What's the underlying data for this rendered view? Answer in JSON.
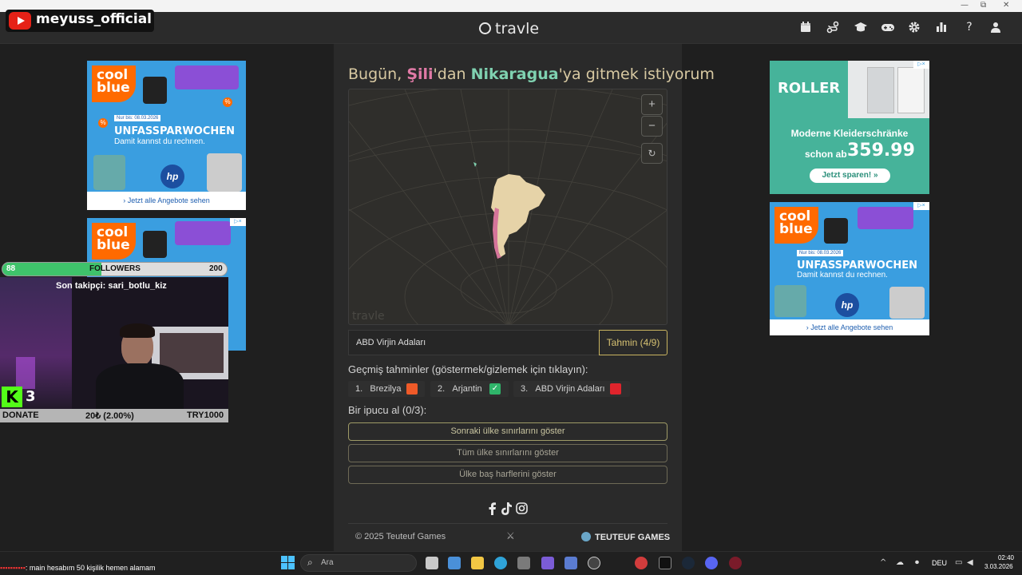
{
  "window": {
    "minimize": "—",
    "maximize": "⧉",
    "close": "✕"
  },
  "header": {
    "brand": "travle",
    "icons": [
      "calendar-icon",
      "route-icon",
      "graduation-cap-icon",
      "gamepad-icon",
      "gear-icon",
      "bar-chart-icon",
      "help-icon",
      "user-icon"
    ]
  },
  "game": {
    "question_prefix": "Bugün, ",
    "from_country": "Şili",
    "question_middle": "'dan ",
    "to_country": "Nikaragua",
    "question_suffix": "'ya gitmek istiyorum",
    "map_zoom_in": "+",
    "map_zoom_out": "−",
    "map_reset": "↻",
    "map_watermark": "travle",
    "guess_value": "ABD Virjin Adaları",
    "guess_button": "Tahmin (4/9)",
    "past_title": "Geçmiş tahminler (göstermek/gizlemek için tıklayın):",
    "past_guesses": [
      {
        "num": "1.",
        "name": "Brezilya",
        "status": "orange",
        "color": "#ef5a28"
      },
      {
        "num": "2.",
        "name": "Arjantin",
        "status": "correct",
        "color": "#2fb56a"
      },
      {
        "num": "3.",
        "name": "ABD Virjin Adaları",
        "status": "red",
        "color": "#e0242c"
      }
    ],
    "hint_title": "Bir ipucu al (0/3):",
    "hints": [
      "Sonraki ülke sınırlarını göster",
      "Tüm ülke sınırlarını göster",
      "Ülke baş harflerini göster"
    ],
    "social": [
      "facebook-icon",
      "tiktok-icon",
      "instagram-icon"
    ],
    "copyright": "© 2025 Teuteuf Games",
    "footer_brand": "TEUTEUF GAMES"
  },
  "ads": {
    "coolblue_logo": "cool blue",
    "coolblue_badge": "Nur bis: 08.03.2026",
    "coolblue_headline": "UNFASSPARWOCHEN",
    "coolblue_sub": "Damit kannst du rechnen.",
    "coolblue_link": "Jetzt alle Angebote sehen",
    "coolblue_hp": "hp",
    "roller_logo": "ROLLER",
    "roller_title_1": "Moderne Kleiderschränke",
    "roller_price_pre": "schon ab",
    "roller_price": "359.99",
    "roller_cta": "Jetzt sparen! »",
    "adchoice": "▷×",
    "accent_coolblue": "#3a9ee0",
    "accent_roller": "#46b39a"
  },
  "stream": {
    "channel": "meyuss_official",
    "followers_current": "88",
    "followers_label": "FOLLOWERS",
    "followers_goal": "200",
    "followers_progress": 0.44,
    "last_follower": "Son takipçi: sari_botlu_kiz",
    "kick_logo": "K",
    "kick_count": "3",
    "donate_label": "DONATE",
    "donate_mid": "20₺ (2.00%)",
    "donate_goal": "TRY1000",
    "chat_text": ": main hesabım 50 kişilik hemen alamam"
  },
  "taskbar": {
    "search_placeholder": "Ara",
    "language": "DEU",
    "time": "02:40",
    "date": "3.03.2026",
    "tray_up": "^"
  }
}
